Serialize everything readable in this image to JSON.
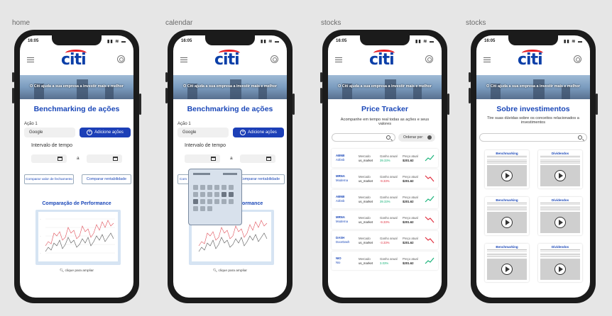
{
  "frames": [
    {
      "label": "home"
    },
    {
      "label": "calendar"
    },
    {
      "label": "stocks"
    },
    {
      "label": "stocks"
    }
  ],
  "status": {
    "time": "16:05"
  },
  "brand": {
    "logo": "citi",
    "banner": "O Citi ajuda a sua empresa a investir mais e melhor"
  },
  "home": {
    "title": "Benchmarking de ações",
    "acao_label": "Ação 1",
    "acao_value": "Google",
    "add_button": "Adicione ações",
    "interval_label": "Intervalo de tempo",
    "sep": "a",
    "compare_close": "Comparar valor de fechamento",
    "compare_return": "Comparar rentabilidade",
    "chart_title": "Comparação de Performance",
    "zoom_hint": "clique para ampliar"
  },
  "calendar": {
    "title": "Benchmarking de ações",
    "acao_label": "Ação 1",
    "acao_value": "Google",
    "add_button": "Adicione ações",
    "interval_label": "Intervalo de tempo",
    "sep": "a",
    "compare_close": "Com",
    "compare_return": "Comparar rentabilidade",
    "chart_title": "rformance",
    "zoom_hint": "clique para ampliar"
  },
  "tracker": {
    "title": "Price Tracker",
    "subtitle": "Acompanhe em tempo real todas as ações e seus valores",
    "order_label": "Ordenar por:",
    "rows": [
      {
        "ticker": "ABNB",
        "name": "Airbnb",
        "mercado": "Mercado",
        "market": "us_market",
        "ganho_label": "Ganho anual",
        "ganho": "39.33%",
        "preco_label": "Preço atual",
        "preco": "$201.62",
        "trend": "up"
      },
      {
        "ticker": "MRNA",
        "name": "Moderna",
        "mercado": "Mercado",
        "market": "us_market",
        "ganho_label": "Ganho anual",
        "ganho": "-9.33%",
        "preco_label": "Preço atual",
        "preco": "$201.62",
        "trend": "down"
      },
      {
        "ticker": "ABNB",
        "name": "Airbnb",
        "mercado": "Mercado",
        "market": "us_market",
        "ganho_label": "Ganho anual",
        "ganho": "39.33%",
        "preco_label": "Preço atual",
        "preco": "$201.62",
        "trend": "up"
      },
      {
        "ticker": "MRNA",
        "name": "Moderna",
        "mercado": "Mercado",
        "market": "us_market",
        "ganho_label": "Ganho anual",
        "ganho": "-9.33%",
        "preco_label": "Preço atual",
        "preco": "$201.62",
        "trend": "down"
      },
      {
        "ticker": "DASH",
        "name": "DoorDash",
        "mercado": "Mercado",
        "market": "us_market",
        "ganho_label": "Ganho anual",
        "ganho": "-3.33%",
        "preco_label": "Preço atual",
        "preco": "$201.62",
        "trend": "down"
      },
      {
        "ticker": "NIO",
        "name": "Nio",
        "mercado": "Mercado",
        "market": "us_market",
        "ganho_label": "Ganho anual",
        "ganho": "3.03%",
        "preco_label": "Preço atual",
        "preco": "$201.62",
        "trend": "up"
      }
    ]
  },
  "about": {
    "title": "Sobre investimentos",
    "subtitle": "Tire suas dúvidas sobre os conceitos relacionados a investimentos",
    "cards": [
      {
        "title": "Benchmarking"
      },
      {
        "title": "Dividendos"
      },
      {
        "title": "Benchmarking"
      },
      {
        "title": "Dividendos"
      },
      {
        "title": "Benchmarking"
      },
      {
        "title": "Dividendos"
      }
    ]
  },
  "colors": {
    "brand_blue": "#1a47b8",
    "button_blue": "#1c3fb7",
    "logo_red": "#e31b23",
    "gain": "#19b37a",
    "loss": "#e03040"
  },
  "icons": [
    "menu-icon",
    "gear-icon",
    "plus-circle-icon",
    "calendar-icon",
    "search-icon",
    "sort-dot-icon",
    "trend-up-icon",
    "trend-down-icon",
    "play-icon",
    "zoom-icon"
  ]
}
